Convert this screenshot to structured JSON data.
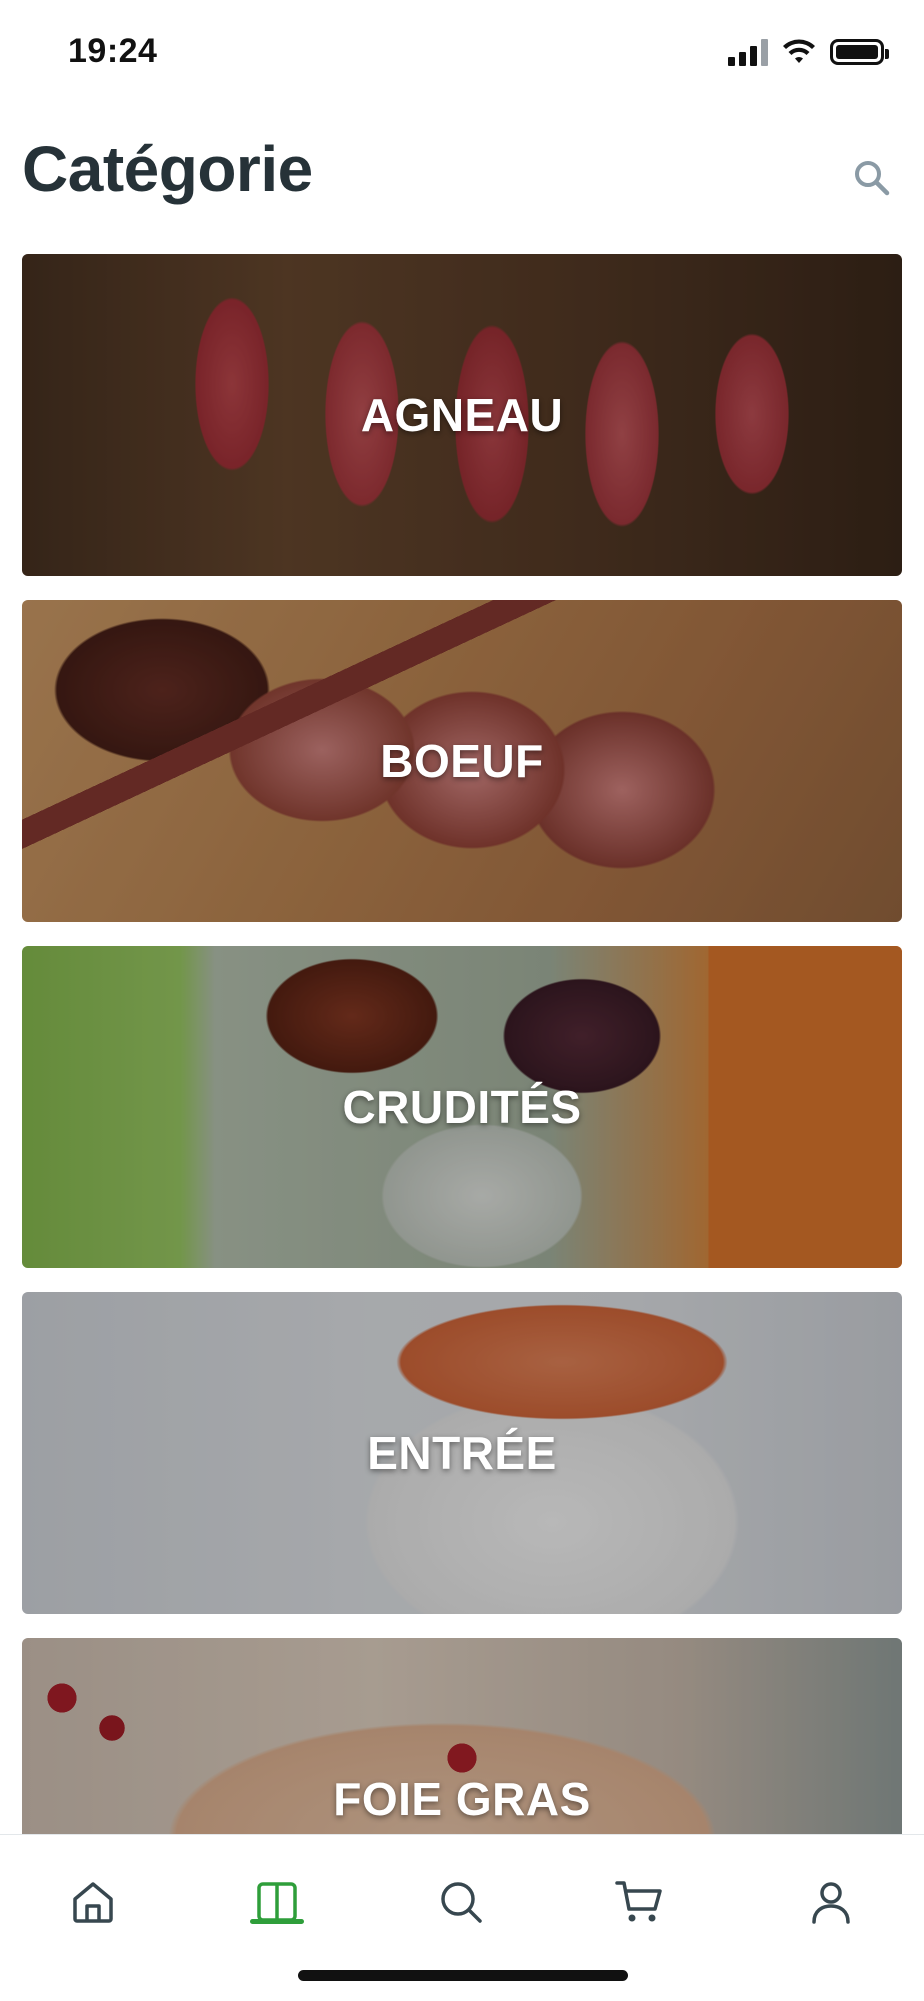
{
  "status_bar": {
    "time": "19:24"
  },
  "header": {
    "title": "Catégorie"
  },
  "categories": [
    {
      "label": "AGNEAU"
    },
    {
      "label": "BOEUF"
    },
    {
      "label": "CRUDITÉS"
    },
    {
      "label": "ENTRÉE"
    },
    {
      "label": "FOIE GRAS"
    }
  ],
  "bottom_nav": {
    "items": [
      {
        "icon": "home-icon",
        "active": false
      },
      {
        "icon": "catalog-icon",
        "active": true
      },
      {
        "icon": "search-icon",
        "active": false
      },
      {
        "icon": "cart-icon",
        "active": false
      },
      {
        "icon": "profile-icon",
        "active": false
      }
    ]
  },
  "colors": {
    "accent": "#2e9e3a",
    "icon_inactive": "#37474f",
    "title": "#263238"
  }
}
